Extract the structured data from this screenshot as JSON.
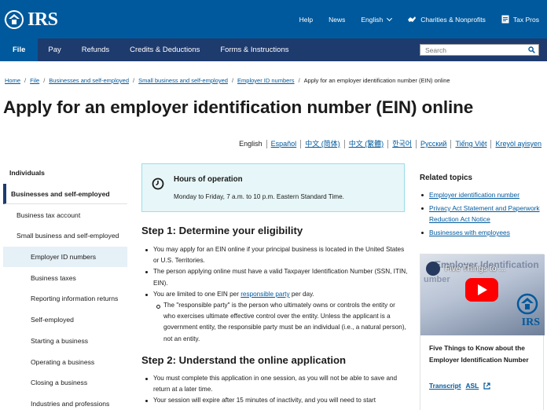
{
  "header": {
    "logo_text": "IRS",
    "utility": [
      {
        "label": "Help",
        "icon": "none"
      },
      {
        "label": "News",
        "icon": "none"
      },
      {
        "label": "English",
        "icon": "chevron-down-icon"
      },
      {
        "label": "Charities & Nonprofits",
        "icon": "handshake-icon"
      },
      {
        "label": "Tax Pros",
        "icon": "tax-pros-icon"
      }
    ],
    "brand_color": "#00599c",
    "nav_color": "#1e3b6e"
  },
  "nav": {
    "tabs": [
      "File",
      "Pay",
      "Refunds",
      "Credits & Deductions",
      "Forms & Instructions"
    ],
    "active": "File",
    "search_placeholder": "Search"
  },
  "breadcrumb": {
    "items": [
      "Home",
      "File",
      "Businesses and self-employed",
      "Small business and self-employed",
      "Employer ID numbers"
    ],
    "current": "Apply for an employer identification number (EIN) online"
  },
  "page": {
    "title": "Apply for an employer identification number (EIN) online"
  },
  "languages": [
    "English",
    "Español",
    "中文 (简体)",
    "中文 (繁體)",
    "한국어",
    "Русский",
    "Tiếng Việt",
    "Kreyòl ayisyen"
  ],
  "sidebar": {
    "items": [
      {
        "label": "Individuals",
        "level": 0
      },
      {
        "label": "Businesses and self-employed",
        "level": 0
      },
      {
        "label": "Business tax account",
        "level": 1
      },
      {
        "label": "Small business and self-employed",
        "level": 1
      },
      {
        "label": "Employer ID numbers",
        "level": 2
      },
      {
        "label": "Business taxes",
        "level": 2
      },
      {
        "label": "Reporting information returns",
        "level": 2
      },
      {
        "label": "Self-employed",
        "level": 2
      },
      {
        "label": "Starting a business",
        "level": 2
      },
      {
        "label": "Operating a business",
        "level": 2
      },
      {
        "label": "Closing a business",
        "level": 2
      },
      {
        "label": "Industries and professions",
        "level": 2
      }
    ]
  },
  "alert": {
    "title": "Hours of operation",
    "body": "Monday to Friday, 7 a.m. to 10 p.m. Eastern Standard Time."
  },
  "step1": {
    "heading": "Step 1: Determine your eligibility",
    "bullets": [
      "You may apply for an EIN online if your principal business is located in the United States or U.S. Territories.",
      "The person applying online must have a valid Taxpayer Identification Number (SSN, ITIN, EIN)."
    ],
    "limit_before": "You are limited to one EIN per ",
    "limit_link": "responsible party",
    "limit_after": " per day.",
    "sub_bullet": "The \"responsible party\" is the person who ultimately owns or controls the entity or who exercises ultimate effective control over the entity. Unless the applicant is a government entity, the responsible party must be an individual (i.e., a natural person), not an entity."
  },
  "step2": {
    "heading": "Step 2: Understand the online application",
    "bullets": [
      "You must complete this application in one session, as you will not be able to save and return at a later time.",
      "Your session will expire after 15 minutes of inactivity, and you will need to start"
    ]
  },
  "related": {
    "title": "Related topics",
    "links": [
      "Employer identification number",
      "Privacy Act Statement and Paperwork Reduction Act Notice",
      "Businesses with employees"
    ]
  },
  "video": {
    "thumb_title": "Five Things to ...",
    "thumb_bg_line1": "Employer Identification",
    "thumb_bg_line2": "umber",
    "thumb_logo": "IRS",
    "caption": "Five Things to Know about the Employer Identification Number",
    "links": [
      "Transcript",
      "ASL"
    ]
  }
}
